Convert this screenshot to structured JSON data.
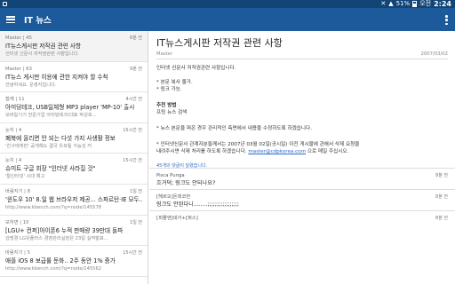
{
  "status": {
    "time": "2:24",
    "ampm": "오전",
    "battery": "51%"
  },
  "appbar": {
    "title": "IT 뉴스"
  },
  "list": [
    {
      "meta": "Master | 45",
      "time": "8분 전",
      "title": "IT뉴스게시판 저작권 관련 사항",
      "snip": "인터넷 신문사 저작권관련 사항입니다."
    },
    {
      "meta": "Master | 63",
      "time": "9분 전",
      "title": "IT뉴스 게시판 이용에 관한 지켜야 할 수칙",
      "snip": "안녕하세요. 운영자입니다."
    },
    {
      "meta": "함께 | 11",
      "time": "4시간 전",
      "title": "아미덩테크, USB일체형 MP3 player 'MP-10' 출시",
      "snip": "모바일기기 전문기업 아미덩테크(대표 박성호..."
    },
    {
      "meta": "눈치 | 4",
      "time": "15시간 전",
      "title": "폐북에 올리면 안 되는 다섯 가지 사생활 정보",
      "snip": "'친구에게만' 공개해도 결국 유포될 가능성 커"
    },
    {
      "meta": "눈치 | 4",
      "time": "15시간 전",
      "title": "슈미트 구글 회장 \"인터넷 사라질 것\"",
      "snip": "'탈인터넷' 시대 예고"
    },
    {
      "meta": "바람지기 | 8",
      "time": "1일 전",
      "title": "'윈도우 10' 8.일 웹 브라우저 제공... 스파르탄·IE 모두...",
      "snip": "http://www.kbench.com/?q=node/145578"
    },
    {
      "meta": "모하면 | 10",
      "time": "1일 전",
      "title": "[LGU+ 컨퍼]아이폰6 누적 판매량 39만대 돌파",
      "snip": "강명경 LG유플러스 경영관리실장은 23일 실적발표..."
    },
    {
      "meta": "바람지기 | 5",
      "time": "15시간 전",
      "title": "애플 iOS 8 보급률 둔화.. 2주 동안 1% 증가",
      "snip": "http://www.kbench.com/?q=node/145562"
    }
  ],
  "article": {
    "title": "IT뉴스게시판 저작권 관련 사항",
    "author": "Master",
    "date": "2007/03/02",
    "body": {
      "intro": "인터넷 신문사 저작권관련 사항입니다.",
      "b1": "* 본문 복사 불가.",
      "b2": "* 링크 가능.",
      "h1": "추천 방법",
      "h2": "프링 뉴스 검색",
      "p3": "* 뉴스 본문을 퍼온 경우 관리적인 측면에서 내용을 수정하도록 하겠습니다.",
      "p4a": "* 인터넷신문사 관계자분들께서는 2007년 03월 02일(공시일) 이전 게시물에 관해서 삭제 요청을",
      "p4b_pre": "내려주시면 삭제 처리를 하도록 하겠습니다.",
      "p4b_email": "master@cdpkorea.com",
      "p4b_post": "으로 메일 주십시오."
    },
    "source": "45개의 댓글이 달렸습니다."
  },
  "comments": [
    {
      "author": "Pisca Punga",
      "time": "8분 전",
      "body": "흐거덕; 링크도 안되나요?"
    },
    {
      "author": "[헤르오]돈데코한",
      "time": "8분 전",
      "body": "링크도 안된다니........;;;;;;;;;;;;;;;;;"
    },
    {
      "author": "[피플앤]네가+[퍼스]",
      "time": "8분 전",
      "body": ""
    }
  ]
}
